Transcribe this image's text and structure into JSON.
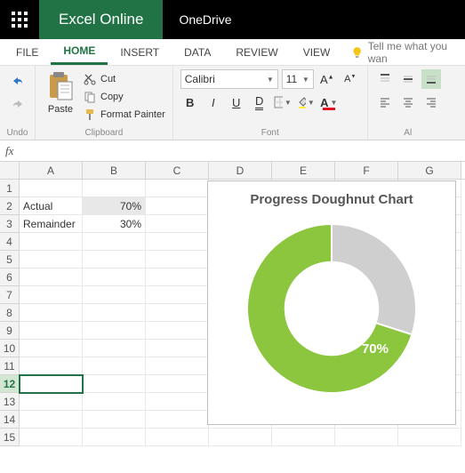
{
  "titlebar": {
    "app": "Excel Online",
    "doc": "OneDrive"
  },
  "tabs": {
    "file": "FILE",
    "home": "HOME",
    "insert": "INSERT",
    "data": "DATA",
    "review": "REVIEW",
    "view": "VIEW",
    "tellme": "Tell me what you wan"
  },
  "ribbon": {
    "undo_group": "Undo",
    "clipboard": {
      "paste": "Paste",
      "cut": "Cut",
      "copy": "Copy",
      "format_painter": "Format Painter",
      "group": "Clipboard"
    },
    "font": {
      "name": "Calibri",
      "size": "11",
      "group": "Font"
    },
    "align": {
      "group": "Al"
    }
  },
  "fx_label": "fx",
  "columns": [
    "A",
    "B",
    "C",
    "D",
    "E",
    "F",
    "G"
  ],
  "row_count": 15,
  "active_row": 12,
  "cells": {
    "A2": "Actual",
    "B2": "70%",
    "A3": "Remainder",
    "B3": "30%"
  },
  "chart_data": {
    "type": "doughnut",
    "title": "Progress Doughnut Chart",
    "series": [
      {
        "name": "Actual",
        "value": 70,
        "color": "#8cc63f"
      },
      {
        "name": "Remainder",
        "value": 30,
        "color": "#cfcfcf"
      }
    ],
    "center_label": "70%",
    "hole_ratio": 0.55
  }
}
